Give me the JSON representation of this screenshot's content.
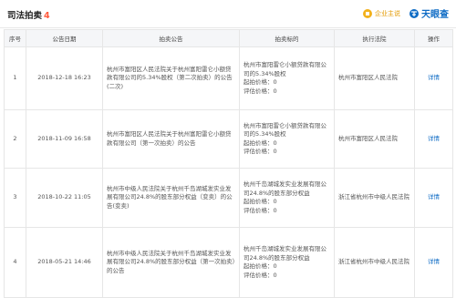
{
  "header": {
    "title": "司法拍卖",
    "count": "4",
    "brand_enterprise": "企业主说",
    "brand_tianyancha": "天眼查"
  },
  "table": {
    "columns": [
      "序号",
      "公告日期",
      "拍卖公告",
      "拍卖标的",
      "执行法院",
      "操作"
    ],
    "rows": [
      {
        "index": "1",
        "date": "2018-12-18 16:23",
        "notice": "杭州市富阳区人民法院关于杭州富阳雷仑小额贷款有限公司的5.34%股权（第二次拍卖）的公告(二次)",
        "target_name": "杭州市富阳雷仑小额贷款有限公司的5.34%股权",
        "target_price": "起拍价格：0",
        "target_eval": "评估价格：0",
        "court": "杭州市富阳区人民法院",
        "action": "详情"
      },
      {
        "index": "2",
        "date": "2018-11-09 16:58",
        "notice": "杭州市富阳区人民法院关于杭州富阳雷仑小额贷款有限公司（第一次拍卖）的公告",
        "target_name": "杭州市富阳雷仑小额贷款有限公司的5.34%股权",
        "target_price": "起拍价格：0",
        "target_eval": "评估价格：0",
        "court": "杭州市富阳区人民法院",
        "action": "详情"
      },
      {
        "index": "3",
        "date": "2018-10-22 11:05",
        "notice": "杭州市中级人民法院关于杭州千岛湖城发实业发展有限公司24.8%的股东部分权益（变卖）的公告(变卖)",
        "target_name": "杭州千岛湖城发实业发展有限公司24.8%的股东部分权益",
        "target_price": "起拍价格：0",
        "target_eval": "评估价格：0",
        "court": "浙江省杭州市中级人民法院",
        "action": "详情"
      },
      {
        "index": "4",
        "date": "2018-05-21 14:46",
        "notice": "杭州市中级人民法院关于杭州千岛湖城发实业发展有限公司24.8%的股东部分权益（第一次拍卖）的公告",
        "target_name": "杭州千岛湖城发实业发展有限公司24.8%的股东部分权益",
        "target_price": "起拍价格：0",
        "target_eval": "评估价格：0",
        "court": "浙江省杭州市中级人民法院",
        "action": "详情"
      }
    ]
  },
  "colors": {
    "accent_count": "#ff5a3c",
    "link": "#0f6cc5",
    "brand_gold": "#f2b11c",
    "header_bg": "#f5f6f8"
  }
}
